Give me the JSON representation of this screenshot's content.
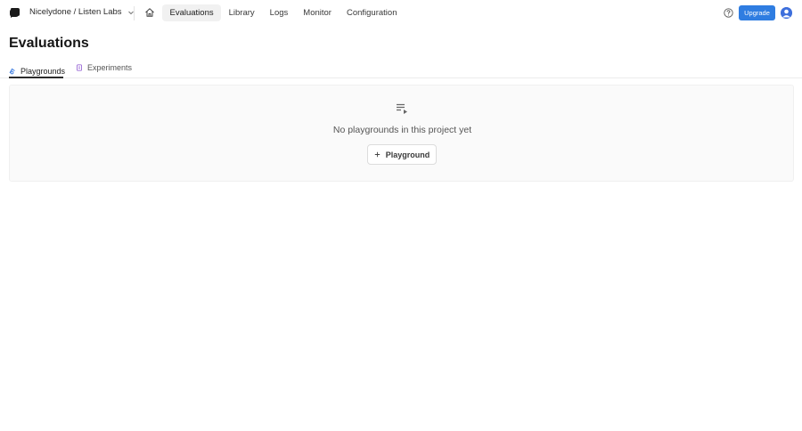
{
  "header": {
    "org_project": "Nicelydone / Listen Labs",
    "nav": [
      "Evaluations",
      "Library",
      "Logs",
      "Monitor",
      "Configuration"
    ],
    "active_nav": "Evaluations",
    "upgrade_label": "Upgrade"
  },
  "page": {
    "title": "Evaluations",
    "tabs": [
      {
        "label": "Playgrounds",
        "active": true
      },
      {
        "label": "Experiments",
        "active": false
      }
    ]
  },
  "empty_state": {
    "message": "No playgrounds in this project yet",
    "button_label": "Playground"
  },
  "colors": {
    "accent": "#2f7de1",
    "experiments_icon": "#9b6bd6",
    "playgrounds_icon": "#3b7be0"
  }
}
